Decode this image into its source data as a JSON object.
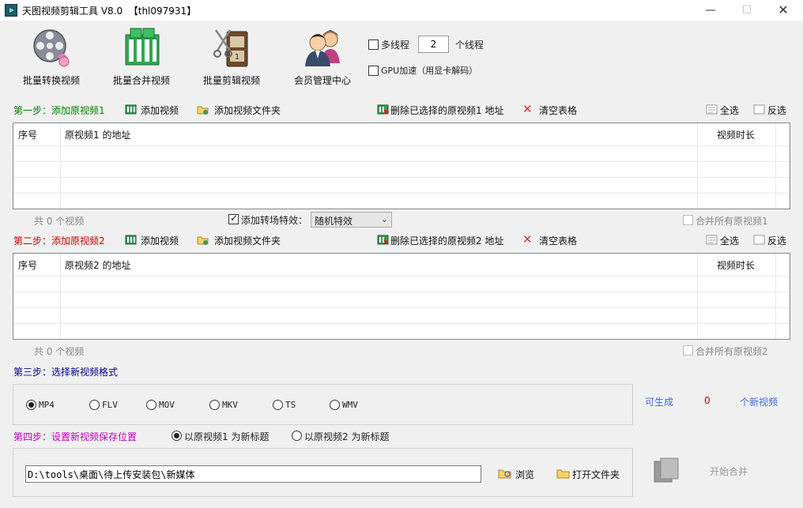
{
  "window": {
    "title": "天图视频剪辑工具 V8.0  【thl097931】",
    "minimize": "—",
    "maximize": "☐",
    "close": "✕"
  },
  "tools": [
    {
      "label": "批量转换视频",
      "icon": "film-reel-icon"
    },
    {
      "label": "批量合并视频",
      "icon": "filmstrip-merge-icon"
    },
    {
      "label": "批量剪辑视频",
      "icon": "film-scissors-icon"
    },
    {
      "label": "会员管理中心",
      "icon": "members-icon"
    }
  ],
  "options": {
    "multithread_label": "多线程",
    "thread_count": "2",
    "thread_suffix": "个线程",
    "gpu_label": "GPU加速（用显卡解码）"
  },
  "step1": {
    "title": "第一步：添加原视频1",
    "add_video": "添加视频",
    "add_folder": "添加视频文件夹",
    "delete_selected": "删除已选择的原视频1 地址",
    "clear_table": "清空表格",
    "select_all": "全选",
    "invert": "反选",
    "col_index": "序号",
    "col_path": "原视频1 的地址",
    "col_duration": "视频时长",
    "count_text": "共 0 个视频",
    "merge_label": "合并所有原视频1"
  },
  "transition": {
    "label": "添加转场特效：",
    "value": "随机特效"
  },
  "step2": {
    "title": "第二步：添加原视频2",
    "add_video": "添加视频",
    "add_folder": "添加视频文件夹",
    "delete_selected": "删除已选择的原视频2 地址",
    "clear_table": "清空表格",
    "select_all": "全选",
    "invert": "反选",
    "col_index": "序号",
    "col_path": "原视频2 的地址",
    "col_duration": "视频时长",
    "count_text": "共 0 个视频",
    "merge_label": "合并所有原视频2"
  },
  "step3": {
    "title": "第三步：选择新视频格式",
    "formats": [
      "MP4",
      "FLV",
      "MOV",
      "MKV",
      "TS",
      "WMV"
    ],
    "selected": "MP4",
    "can_generate": "可生成",
    "count": "0",
    "suffix": "个新视频"
  },
  "step4": {
    "title": "第四步：设置新视频保存位置",
    "option1": "以原视频1 为新标题",
    "option2": "以原视频2 为新标题",
    "path": "D:\\tools\\桌面\\待上传安装包\\新媒体",
    "browse": "浏览",
    "open_folder": "打开文件夹",
    "start": "开始合并"
  },
  "colors": {
    "step1": "#008000",
    "step2": "#cc0000",
    "step3": "#00008b",
    "step4": "#c000c0",
    "link_blue": "#4169e1",
    "count_red": "#cc0000"
  }
}
